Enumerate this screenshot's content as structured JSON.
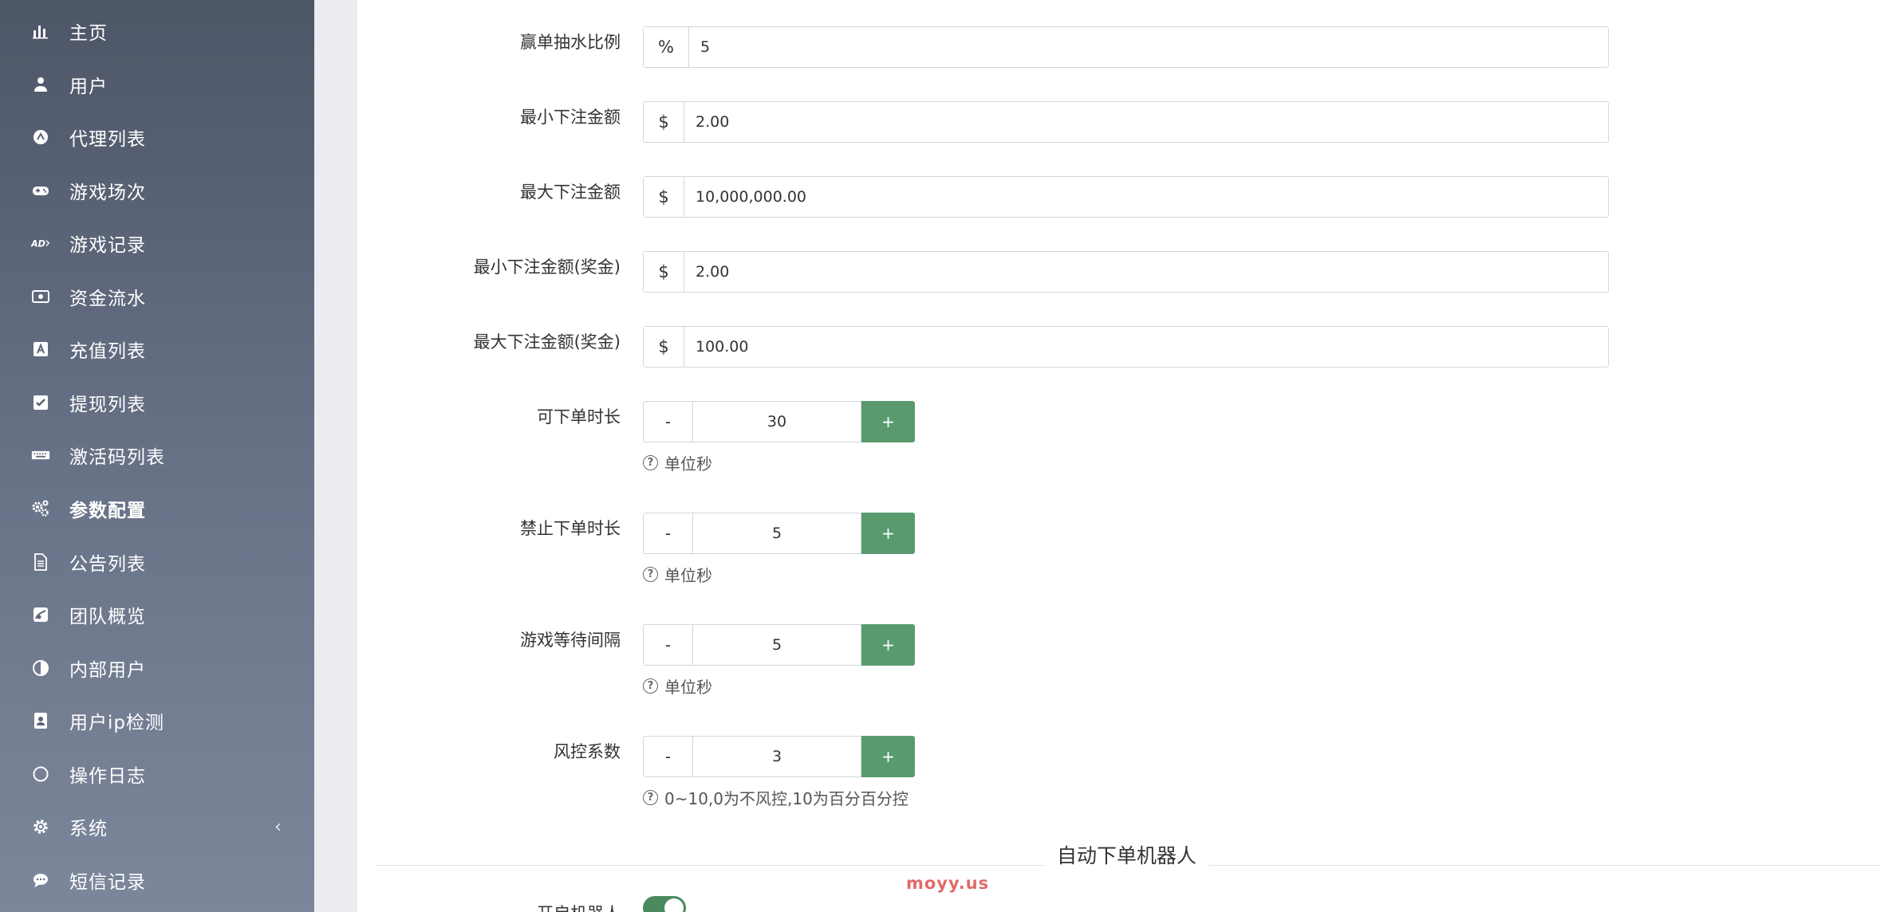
{
  "sidebar": {
    "items": [
      {
        "label": "主页",
        "icon": "bar-chart-icon"
      },
      {
        "label": "用户",
        "icon": "user-icon"
      },
      {
        "label": "代理列表",
        "icon": "agent-icon"
      },
      {
        "label": "游戏场次",
        "icon": "gamepad-icon"
      },
      {
        "label": "游戏记录",
        "icon": "ad-icon"
      },
      {
        "label": "资金流水",
        "icon": "money-icon"
      },
      {
        "label": "充值列表",
        "icon": "recharge-icon"
      },
      {
        "label": "提现列表",
        "icon": "check-square-icon"
      },
      {
        "label": "激活码列表",
        "icon": "keyboard-icon"
      },
      {
        "label": "参数配置",
        "icon": "cogs-icon"
      },
      {
        "label": "公告列表",
        "icon": "file-text-icon"
      },
      {
        "label": "团队概览",
        "icon": "team-icon"
      },
      {
        "label": "内部用户",
        "icon": "adjust-icon"
      },
      {
        "label": "用户ip检测",
        "icon": "id-badge-icon"
      },
      {
        "label": "操作日志",
        "icon": "circle-icon"
      },
      {
        "label": "系统",
        "icon": "gear-icon"
      },
      {
        "label": "短信记录",
        "icon": "comment-icon"
      }
    ],
    "active_label": "参数配置",
    "system_chevron": "‹"
  },
  "form": {
    "fields": [
      {
        "label": "赢单抽水比例",
        "prefix": "%",
        "value": "5"
      },
      {
        "label": "最小下注金额",
        "prefix": "$",
        "value": "2.00"
      },
      {
        "label": "最大下注金额",
        "prefix": "$",
        "value": "10,000,000.00"
      },
      {
        "label": "最小下注金额(奖金)",
        "prefix": "$",
        "value": "2.00"
      },
      {
        "label": "最大下注金额(奖金)",
        "prefix": "$",
        "value": "100.00"
      }
    ],
    "steppers": [
      {
        "label": "可下单时长",
        "value": "30",
        "help": "单位秒"
      },
      {
        "label": "禁止下单时长",
        "value": "5",
        "help": "单位秒"
      },
      {
        "label": "游戏等待间隔",
        "value": "5",
        "help": "单位秒"
      },
      {
        "label": "风控系数",
        "value": "3",
        "help": "0~10,0为不风控,10为百分百分控"
      }
    ],
    "minus_label": "-",
    "plus_label": "+",
    "help_glyph": "?",
    "section_title": "自动下单机器人",
    "robot_toggle_label": "开启机器人",
    "robot_toggle_on": true
  },
  "watermark": "moyy.us",
  "colors": {
    "accent_green": "#5a9a6f",
    "toggle_green": "#4a8a5d",
    "sidebar_top": "#4d5667",
    "sidebar_bottom": "#7c879b",
    "watermark": "#e06a6a"
  }
}
